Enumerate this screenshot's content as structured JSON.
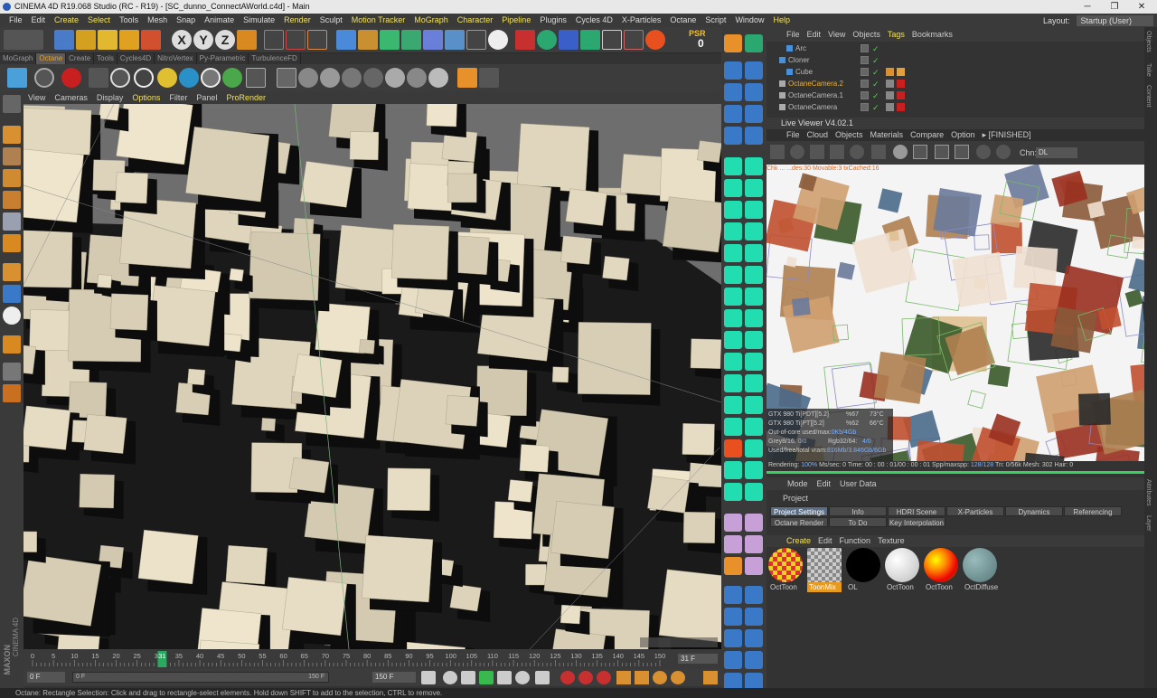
{
  "window": {
    "title": "CINEMA 4D R19.068 Studio (RC - R19) - [SC_dunno_ConnectAWorld.c4d] - Main",
    "min_glyph": "─",
    "max_glyph": "❐",
    "close_glyph": "✕"
  },
  "menubar": {
    "items": [
      "File",
      "Edit",
      "Create",
      "Select",
      "Tools",
      "Mesh",
      "Snap",
      "Animate",
      "Simulate",
      "Render",
      "Sculpt",
      "Motion Tracker",
      "MoGraph",
      "Character",
      "Pipeline",
      "Plugins",
      "Cycles 4D",
      "X-Particles",
      "Octane",
      "Script",
      "Window",
      "Help"
    ],
    "highlighted": [
      "Create",
      "Select",
      "Render",
      "Motion Tracker",
      "MoGraph",
      "Character",
      "Pipeline",
      "Help"
    ],
    "layout_label": "Layout:",
    "layout_value": "Startup (User)"
  },
  "toolbar": {
    "axis_buttons": [
      "X",
      "Y",
      "Z"
    ],
    "psr_label": "PSR",
    "psr_value": "0"
  },
  "plugin_tabs": {
    "items": [
      "MoGraph",
      "Octane",
      "Create",
      "Tools",
      "Cycles4D",
      "NitroVertex",
      "Py-Parametric",
      "TurbulenceFD"
    ],
    "active": "Octane"
  },
  "viewport_menu": {
    "items": [
      "View",
      "Cameras",
      "Display",
      "Options",
      "Filter",
      "Panel",
      "ProRender"
    ],
    "highlighted": [
      "Options",
      "ProRender"
    ]
  },
  "object_manager": {
    "menu": [
      "File",
      "Edit",
      "View",
      "Objects",
      "Tags",
      "Bookmarks"
    ],
    "highlighted": [
      "Tags"
    ],
    "rows": [
      {
        "name": "Arc",
        "indent": 1,
        "highlight": false
      },
      {
        "name": "Cloner",
        "indent": 0,
        "highlight": false
      },
      {
        "name": "Cube",
        "indent": 1,
        "highlight": false
      },
      {
        "name": "OctaneCamera.2",
        "indent": 0,
        "highlight": true
      },
      {
        "name": "OctaneCamera.1",
        "indent": 0,
        "highlight": false
      },
      {
        "name": "OctaneCamera",
        "indent": 0,
        "highlight": false
      }
    ]
  },
  "live_viewer": {
    "title": "Live Viewer V4.02.1",
    "menu": [
      "File",
      "Cloud",
      "Objects",
      "Materials",
      "Compare",
      "Option"
    ],
    "status_tag": "▸ [FINISHED]",
    "channel_label": "Chn:",
    "channel_value": "DL",
    "overlay_text": "Chk    ...    ...des:30 Movable:3 txCached:16",
    "gpu_stats": [
      {
        "name": "GTX 980 Ti[PDT][5.2]",
        "pct": "%67",
        "temp": "73°C"
      },
      {
        "name": "GTX 980 Ti[PT][5.2]",
        "pct": "%62",
        "temp": "66°C"
      }
    ],
    "out_of_core_label": "Out-of-core used/max:",
    "out_of_core_value": "0Kb/4Gb",
    "grey_label": "Grey8/16:",
    "grey_value": "0/0",
    "rgb_label": "Rgb32/64:",
    "rgb_value": "4/0",
    "vram_label": "Used/free/total vram:",
    "vram_value": "816Mb/3.846Gb/6Gb",
    "status": {
      "rendering_label": "Rendering:",
      "rendering": "100%",
      "mssec_label": "Ms/sec:",
      "mssec": "0",
      "time_label": "Time:",
      "time": "00 : 00 : 01/00 : 00 : 01",
      "spp_label": "Spp/maxspp:",
      "spp": "128/128",
      "tri_label": "Tri:",
      "tri": "0/56k",
      "mesh_label": "Mesh:",
      "mesh": "302",
      "hair_label": "Hair:",
      "hair": "0"
    },
    "progress": 1.0
  },
  "attribute_manager": {
    "menu": [
      "Mode",
      "Edit",
      "User Data"
    ],
    "section": "Project",
    "row1": [
      "Project Settings",
      "Info",
      "HDRI Scene Hook",
      "X-Particles",
      "Dynamics",
      "Referencing"
    ],
    "row2": [
      "Octane Render",
      "To Do",
      "Key Interpolation"
    ],
    "active": "Project Settings"
  },
  "material_manager": {
    "menu": [
      "Create",
      "Edit",
      "Function",
      "Texture"
    ],
    "highlighted": [
      "Create"
    ],
    "materials": [
      {
        "name": "OctToon",
        "kind": "checker"
      },
      {
        "name": "ToonMix",
        "kind": "mix"
      },
      {
        "name": "OL",
        "kind": "black"
      },
      {
        "name": "OctToon",
        "kind": "white"
      },
      {
        "name": "OctToon",
        "kind": "rainbow"
      },
      {
        "name": "OctDiffuse",
        "kind": "teal"
      }
    ],
    "active_index": 1
  },
  "timeline": {
    "ticks": [
      "0",
      "5",
      "10",
      "15",
      "20",
      "25",
      "30",
      "35",
      "40",
      "45",
      "50",
      "55",
      "60",
      "65",
      "70",
      "75",
      "80",
      "85",
      "90",
      "95",
      "100",
      "105",
      "110",
      "115",
      "120",
      "125",
      "130",
      "135",
      "140",
      "145",
      "150"
    ],
    "max_frame": 150,
    "current_frame": 31,
    "current_label": "31",
    "frame_readout": "31 F"
  },
  "transport": {
    "start_field": "0 F",
    "slider_start": "0 F",
    "slider_end": "150 F",
    "end_field": "150 F"
  },
  "statusbar": {
    "text": "Octane:          Rectangle Selection: Click and drag to rectangle-select elements. Hold down SHIFT to add to the selection, CTRL to remove."
  },
  "side_labels": {
    "brand_line1": "MAXON",
    "brand_line2": "CINEMA 4D",
    "right_tabs": [
      "Objects",
      "Take",
      "Content"
    ],
    "right_tabs2": [
      "Attributes",
      "Layer"
    ]
  },
  "colors": {
    "octane_icon": "#22ddb0",
    "accent_yellow": "#f0e060",
    "accent_orange": "#e69b20",
    "bg_dark": "#333333"
  }
}
